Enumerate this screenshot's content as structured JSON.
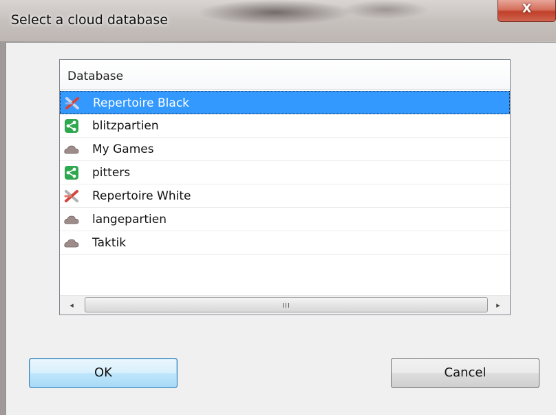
{
  "window": {
    "title": "Select a cloud database",
    "close_label": "X"
  },
  "list": {
    "column_header": "Database",
    "selected_index": 0,
    "items": [
      {
        "label": "Repertoire Black",
        "icon": "repertoire-icon"
      },
      {
        "label": "blitzpartien",
        "icon": "share-icon"
      },
      {
        "label": "My Games",
        "icon": "cloud-icon"
      },
      {
        "label": "pitters",
        "icon": "share-icon"
      },
      {
        "label": "Repertoire White",
        "icon": "repertoire-icon"
      },
      {
        "label": "langepartien",
        "icon": "cloud-icon"
      },
      {
        "label": "Taktik",
        "icon": "cloud-icon"
      }
    ]
  },
  "scrollbar": {
    "left_arrow": "◂",
    "right_arrow": "▸",
    "grip": "III"
  },
  "buttons": {
    "ok_label": "OK",
    "cancel_label": "Cancel"
  },
  "colors": {
    "selection": "#3399ff",
    "share_icon": "#2fa84f",
    "cloud_icon": "#9e8c8a",
    "repertoire_icon": "#d6453b"
  }
}
